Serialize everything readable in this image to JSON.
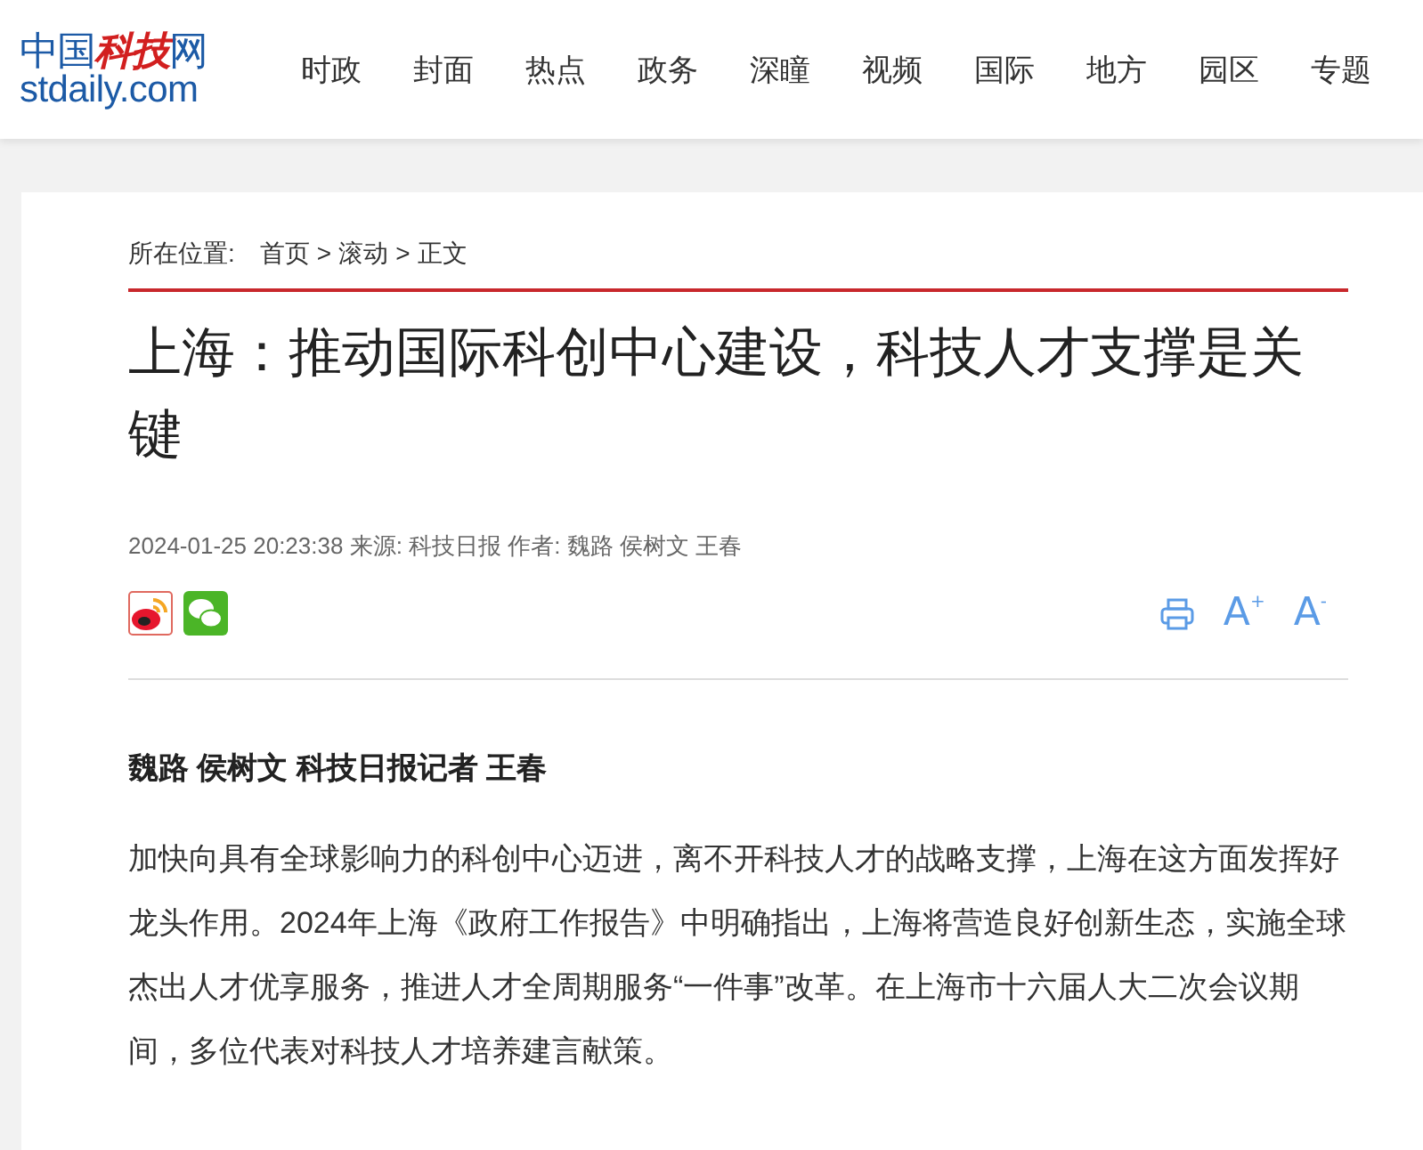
{
  "logo": {
    "cn_left": "中国",
    "cn_red": "科技",
    "cn_right": "网",
    "domain": "stdaily.com"
  },
  "nav": [
    "时政",
    "封面",
    "热点",
    "政务",
    "深瞳",
    "视频",
    "国际",
    "地方",
    "园区",
    "专题"
  ],
  "breadcrumb": {
    "label": "所在位置:",
    "items": [
      "首页",
      "滚动",
      "正文"
    ],
    "separator": ">"
  },
  "article": {
    "title": "上海：推动国际科创中心建设，科技人才支撑是关键",
    "meta": "2024-01-25 20:23:38 来源: 科技日报 作者: 魏路 侯树文 王春",
    "share": [
      {
        "kind": "weibo"
      },
      {
        "kind": "wechat"
      }
    ],
    "tools": [
      {
        "kind": "print"
      },
      {
        "kind": "font",
        "label": "A",
        "sign": "+"
      },
      {
        "kind": "font",
        "label": "A",
        "sign": "-"
      }
    ],
    "byline": "魏路 侯树文 科技日报记者 王春",
    "paragraphs": [
      "加快向具有全球影响力的科创中心迈进，离不开科技人才的战略支撑，上海在这方面发挥好龙头作用。2024年上海《政府工作报告》中明确指出，上海将营造良好创新生态，实施全球杰出人才优享服务，推进人才全周期服务“一件事”改革。在上海市十六届人大二次会议期间，多位代表对科技人才培养建言献策。"
    ]
  }
}
